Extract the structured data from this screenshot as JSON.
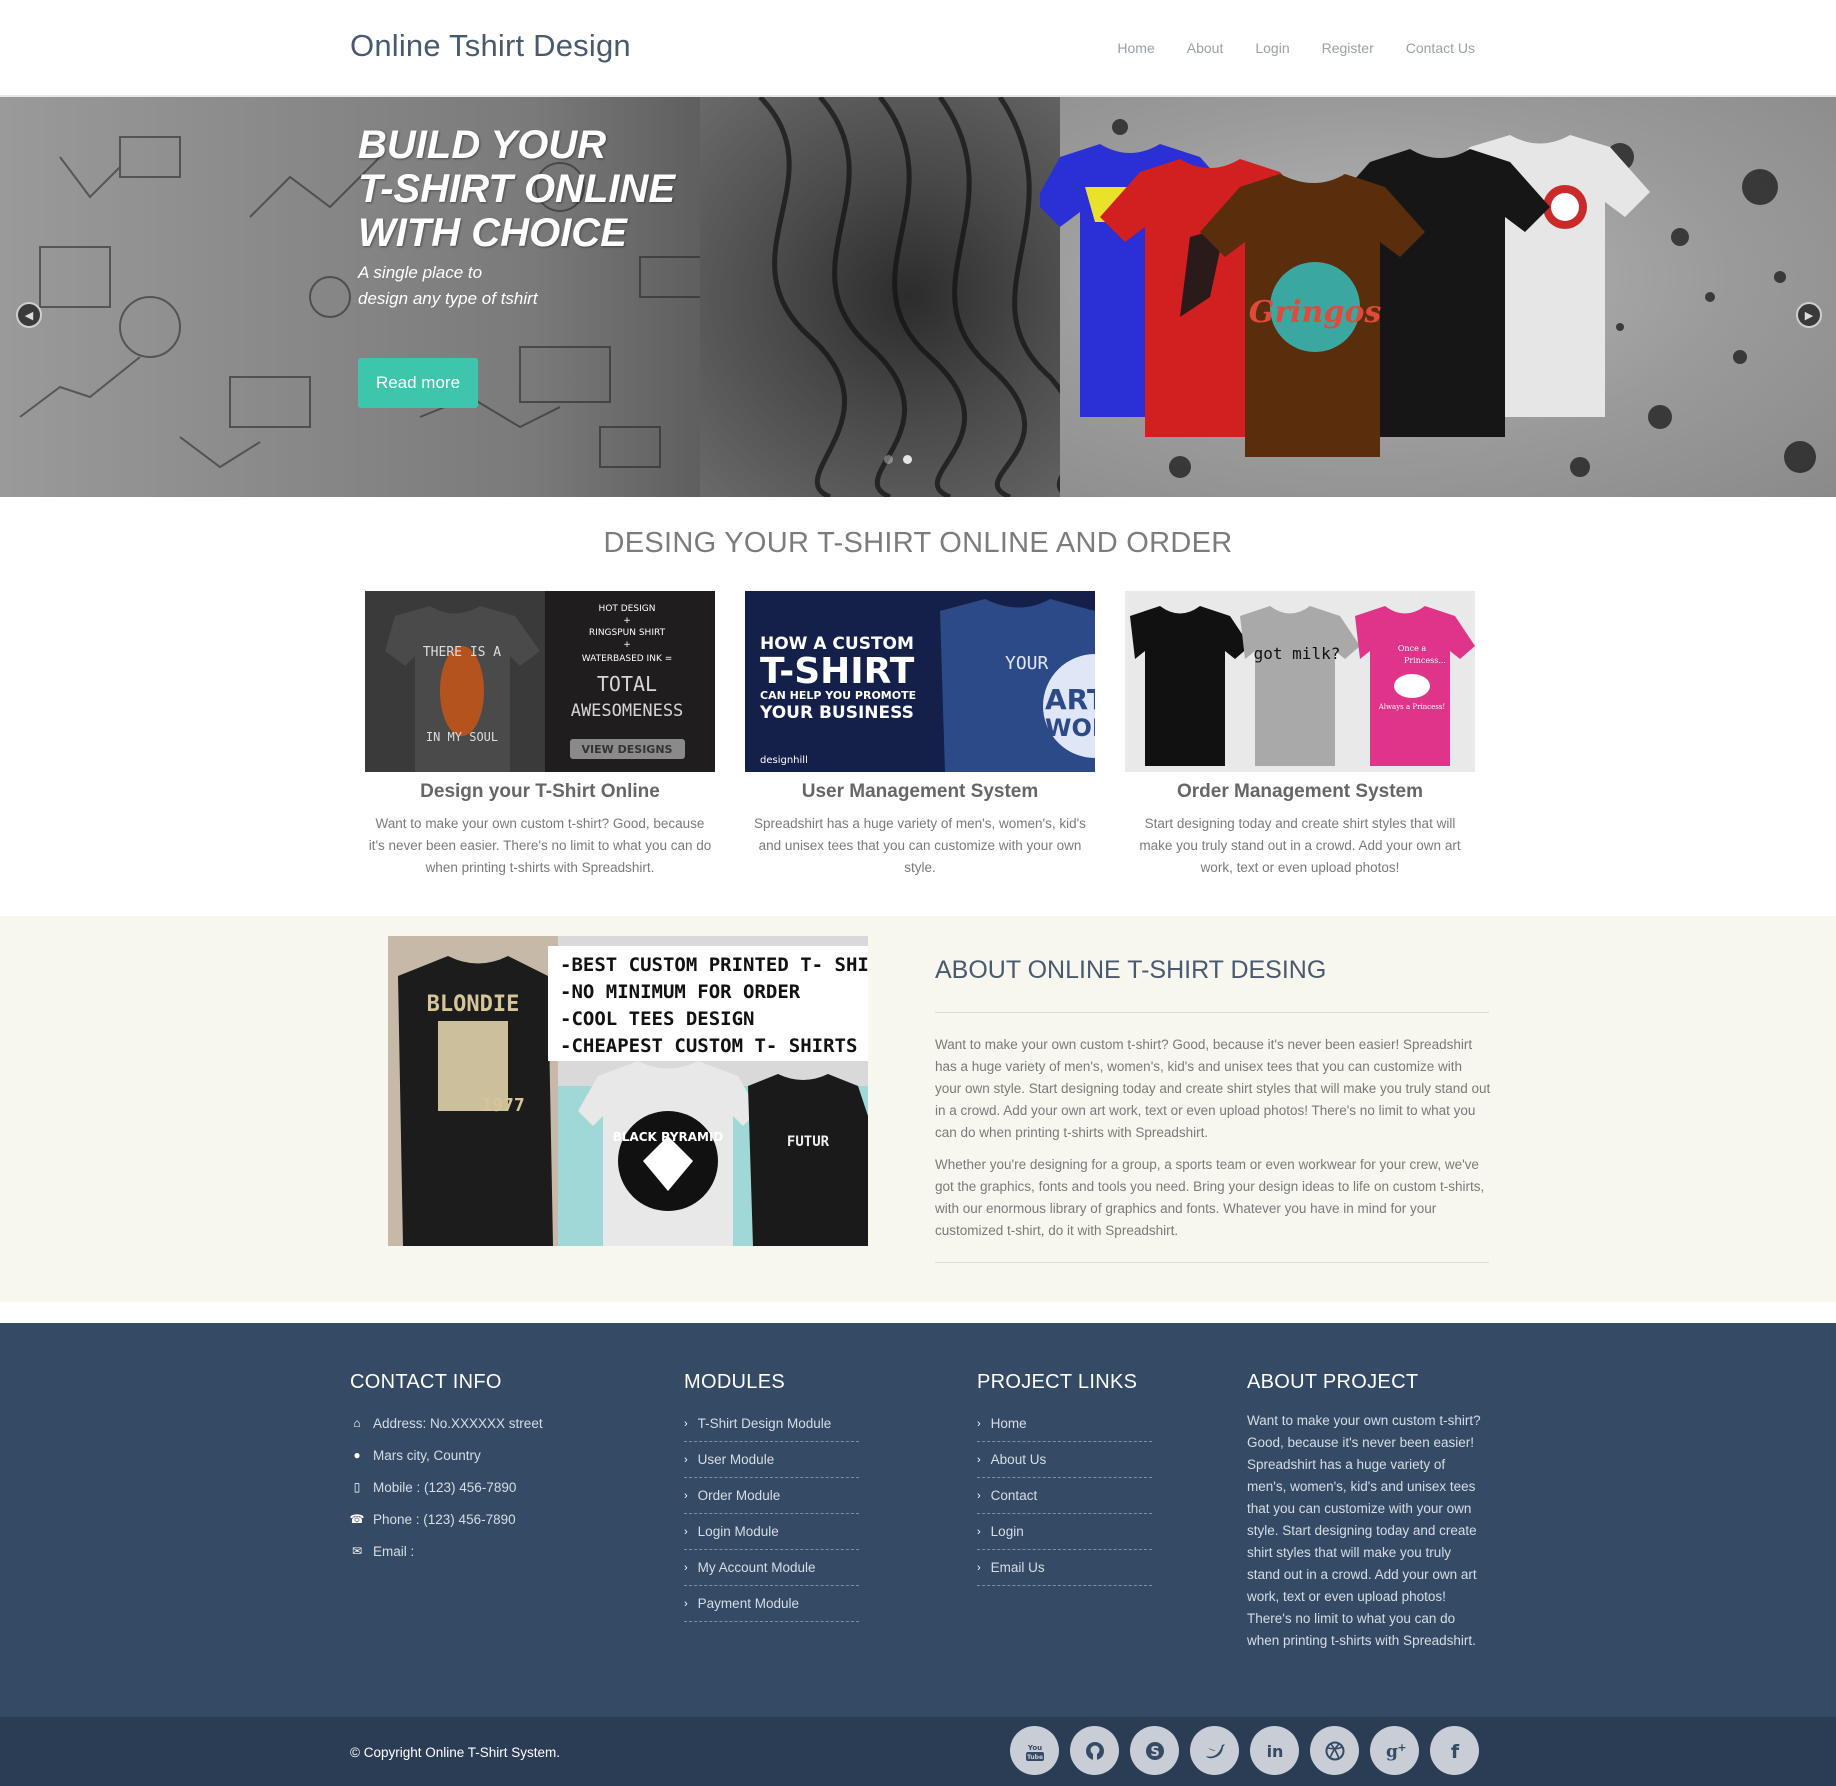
{
  "header": {
    "brand": "Online Tshirt Design",
    "nav": [
      "Home",
      "About",
      "Login",
      "Register",
      "Contact Us"
    ]
  },
  "hero": {
    "title_line1": "BUILD YOUR",
    "title_line2": "T-SHIRT ONLINE",
    "title_line3": "WITH CHOICE",
    "subtitle_line1": "A single place to",
    "subtitle_line2": "design any type of tshirt",
    "button": "Read more",
    "slide_count": 2,
    "active_slide": 2,
    "tee_colors": [
      "#2a2fd6",
      "#d21f1f",
      "#5a2d0c",
      "#161616",
      "#e6e6e6"
    ],
    "tee_print_text": "Gringos"
  },
  "features": {
    "title": "DESING YOUR T-SHIRT ONLINE AND ORDER",
    "items": [
      {
        "heading": "Design your T-Shirt Online",
        "text": "Want to make your own custom t-shirt? Good, because it's never been easier. There's no limit to what you can do when printing t-shirts with Spreadshirt.",
        "image_text": [
          "THERE IS A",
          "IN MY SOUL",
          "HOT DESIGN",
          "+",
          "RINGSPUN SHIRT",
          "+",
          "WATERBASED INK =",
          "TOTAL",
          "AWESOMENESS",
          "VIEW DESIGNS"
        ]
      },
      {
        "heading": "User Management System",
        "text": "Spreadshirt has a huge variety of men's, women's, kid's and unisex tees that you can customize with your own style.",
        "image_text": [
          "HOW A CUSTOM",
          "T-SHIRT",
          "CAN HELP YOU PROMOTE",
          "YOUR BUSINESS",
          "YOUR",
          "ART",
          "WOR",
          "designhill"
        ]
      },
      {
        "heading": "Order Management System",
        "text": "Start designing today and create shirt styles that will make you truly stand out in a crowd. Add your own art work, text or even upload photos!",
        "image_text": [
          "got milk?",
          "Once a",
          "Princess...",
          "Always a Princess!"
        ]
      }
    ]
  },
  "about": {
    "title": "ABOUT ONLINE T-SHIRT DESING",
    "p1": "Want to make your own custom t-shirt? Good, because it's never been easier! Spreadshirt has a huge variety of men's, women's, kid's and unisex tees that you can customize with your own style. Start designing today and create shirt styles that will make you truly stand out in a crowd. Add your own art work, text or even upload photos! There's no limit to what you can do when printing t-shirts with Spreadshirt.",
    "p2": "Whether you're designing for a group, a sports team or even workwear for your crew, we've got the graphics, fonts and tools you need. Bring your design ideas to life on custom t-shirts, with our enormous library of graphics and fonts. Whatever you have in mind for your customized t-shirt, do it with Spreadshirt.",
    "image_text": [
      "-BEST CUSTOM PRINTED T- SHIRTS",
      "-NO MINIMUM FOR ORDER",
      "-COOL TEES DESIGN",
      "-CHEAPEST CUSTOM T- SHIRTS",
      "BLONDIE",
      "1977",
      "BLACK PYRAMID",
      "FUTUR"
    ]
  },
  "footer": {
    "contact": {
      "title": "CONTACT INFO",
      "address": "Address: No.XXXXXX street",
      "city": "Mars city, Country",
      "mobile": "Mobile : (123) 456-7890",
      "phone": "Phone : (123) 456-7890",
      "email": "Email :"
    },
    "modules": {
      "title": "MODULES",
      "items": [
        "T-Shirt Design Module",
        "User Module",
        "Order Module",
        "Login Module",
        "My Account Module",
        "Payment Module"
      ]
    },
    "links": {
      "title": "PROJECT LINKS",
      "items": [
        "Home",
        "About Us",
        "Contact",
        "Login",
        "Email Us"
      ]
    },
    "about": {
      "title": "ABOUT PROJECT",
      "text": "Want to make your own custom t-shirt? Good, because it's never been easier! Spreadshirt has a huge variety of men's, women's, kid's and unisex tees that you can customize with your own style. Start designing today and create shirt styles that will make you truly stand out in a crowd. Add your own art work, text or even upload photos! There's no limit to what you can do when printing t-shirts with Spreadshirt."
    },
    "copyright": "© Copyright Online T-Shirt System.",
    "socials": [
      {
        "name": "youtube-icon",
        "glyph": "You Tube"
      },
      {
        "name": "github-icon",
        "glyph": ""
      },
      {
        "name": "skype-icon",
        "glyph": "S"
      },
      {
        "name": "twitter-icon",
        "glyph": ""
      },
      {
        "name": "linkedin-icon",
        "glyph": "in"
      },
      {
        "name": "dribbble-icon",
        "glyph": ""
      },
      {
        "name": "google-plus-icon",
        "glyph": "g+"
      },
      {
        "name": "facebook-icon",
        "glyph": "f"
      }
    ]
  },
  "colors": {
    "accent": "#3ec6ac",
    "footer": "#354a64",
    "footer_bottom": "#2b3d54",
    "about_bg": "#f7f6ef"
  }
}
